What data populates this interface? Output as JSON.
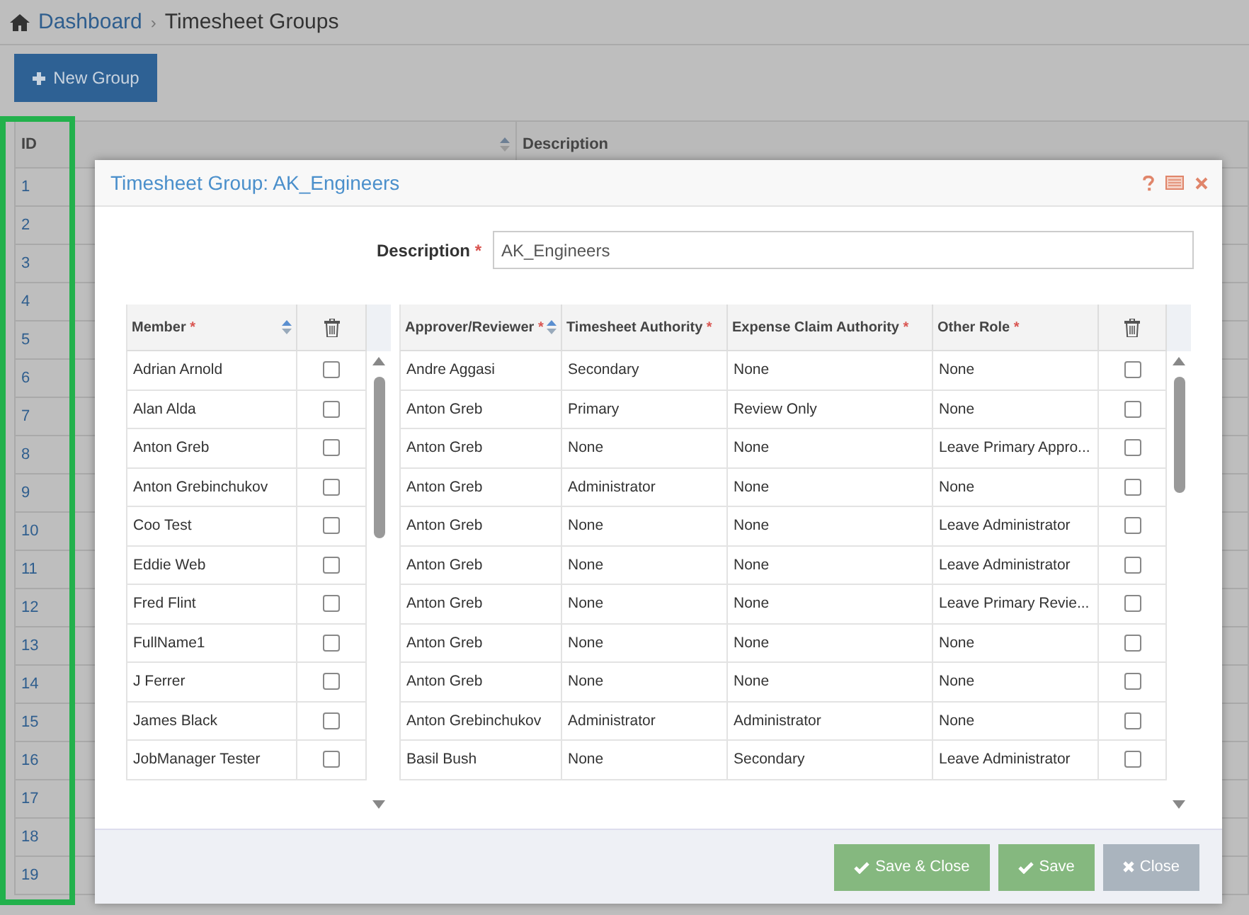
{
  "breadcrumb": {
    "separator": "›",
    "items": [
      {
        "label": "Dashboard",
        "kind": "link"
      },
      {
        "label": "Timesheet Groups",
        "kind": "current"
      }
    ]
  },
  "toolbar": {
    "new_button": "New Group"
  },
  "groups_table": {
    "columns": [
      "ID",
      "Description"
    ],
    "rows": [
      "1",
      "2",
      "3",
      "4",
      "5",
      "6",
      "7",
      "8",
      "9",
      "10",
      "11",
      "12",
      "13",
      "14",
      "15",
      "16",
      "17",
      "18",
      "19"
    ]
  },
  "dialog": {
    "title": "Timesheet Group: AK_Engineers",
    "description": {
      "label": "Description",
      "required_mark": "*",
      "value": "AK_Engineers"
    },
    "members": {
      "columns": [
        {
          "label": "Member",
          "required_mark": "*",
          "sortable": true
        }
      ],
      "rows": [
        {
          "name": "Adrian Arnold",
          "checked": false
        },
        {
          "name": "Alan Alda",
          "checked": false
        },
        {
          "name": "Anton Greb",
          "checked": false
        },
        {
          "name": "Anton Grebinchukov",
          "checked": false
        },
        {
          "name": "Coo Test",
          "checked": false
        },
        {
          "name": "Eddie Web",
          "checked": false
        },
        {
          "name": "Fred Flint",
          "checked": false
        },
        {
          "name": "FullName1",
          "checked": false
        },
        {
          "name": "J Ferrer",
          "checked": false
        },
        {
          "name": "James Black",
          "checked": false
        },
        {
          "name": "JobManager Tester",
          "checked": false
        }
      ]
    },
    "approvers": {
      "columns": [
        {
          "label": "Approver/Reviewer",
          "required_mark": "*",
          "sortable": true
        },
        {
          "label": "Timesheet Authority",
          "required_mark": "*"
        },
        {
          "label": "Expense Claim Authority",
          "required_mark": "*"
        },
        {
          "label": "Other Role",
          "required_mark": "*"
        }
      ],
      "rows": [
        {
          "cells": [
            "Andre Aggasi",
            "Secondary",
            "None",
            "None"
          ],
          "checked": false
        },
        {
          "cells": [
            "Anton Greb",
            "Primary",
            "Review Only",
            "None"
          ],
          "checked": false
        },
        {
          "cells": [
            "Anton Greb",
            "None",
            "None",
            "Leave Primary Appro..."
          ],
          "checked": false
        },
        {
          "cells": [
            "Anton Greb",
            "Administrator",
            "None",
            "None"
          ],
          "checked": false
        },
        {
          "cells": [
            "Anton Greb",
            "None",
            "None",
            "Leave Administrator"
          ],
          "checked": false
        },
        {
          "cells": [
            "Anton Greb",
            "None",
            "None",
            "Leave Administrator"
          ],
          "checked": false
        },
        {
          "cells": [
            "Anton Greb",
            "None",
            "None",
            "Leave Primary Revie..."
          ],
          "checked": false
        },
        {
          "cells": [
            "Anton Greb",
            "None",
            "None",
            "None"
          ],
          "checked": false
        },
        {
          "cells": [
            "Anton Greb",
            "None",
            "None",
            "None"
          ],
          "checked": false
        },
        {
          "cells": [
            "Anton Grebinchukov",
            "Administrator",
            "Administrator",
            "None"
          ],
          "checked": false
        },
        {
          "cells": [
            "Basil Bush",
            "None",
            "Secondary",
            "Leave Administrator"
          ],
          "checked": false
        }
      ]
    },
    "buttons": [
      {
        "label": "Save & Close",
        "kind": "save"
      },
      {
        "label": "Save",
        "kind": "save"
      },
      {
        "label": "Close",
        "kind": "cancel"
      }
    ]
  }
}
